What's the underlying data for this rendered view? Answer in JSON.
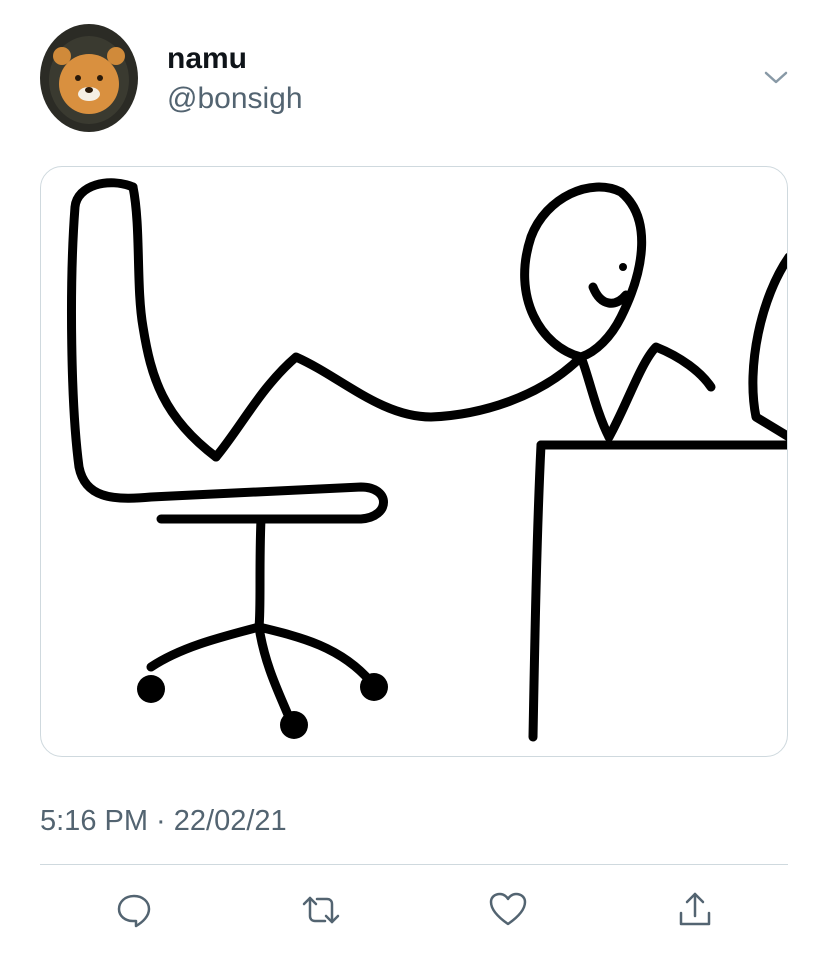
{
  "tweet": {
    "author": {
      "display_name": "namu",
      "handle": "@bonsigh"
    },
    "timestamp": "5:16 PM · 22/02/21",
    "media": {
      "kind": "stick-figure-drawing"
    }
  },
  "actions": {
    "reply_icon": "speech-bubble-icon",
    "retweet_icon": "retweet-arrows-icon",
    "like_icon": "heart-icon",
    "share_icon": "share-upload-icon"
  },
  "colors": {
    "text_primary": "#0f1419",
    "text_secondary": "#536471",
    "border": "#cfd9de"
  }
}
